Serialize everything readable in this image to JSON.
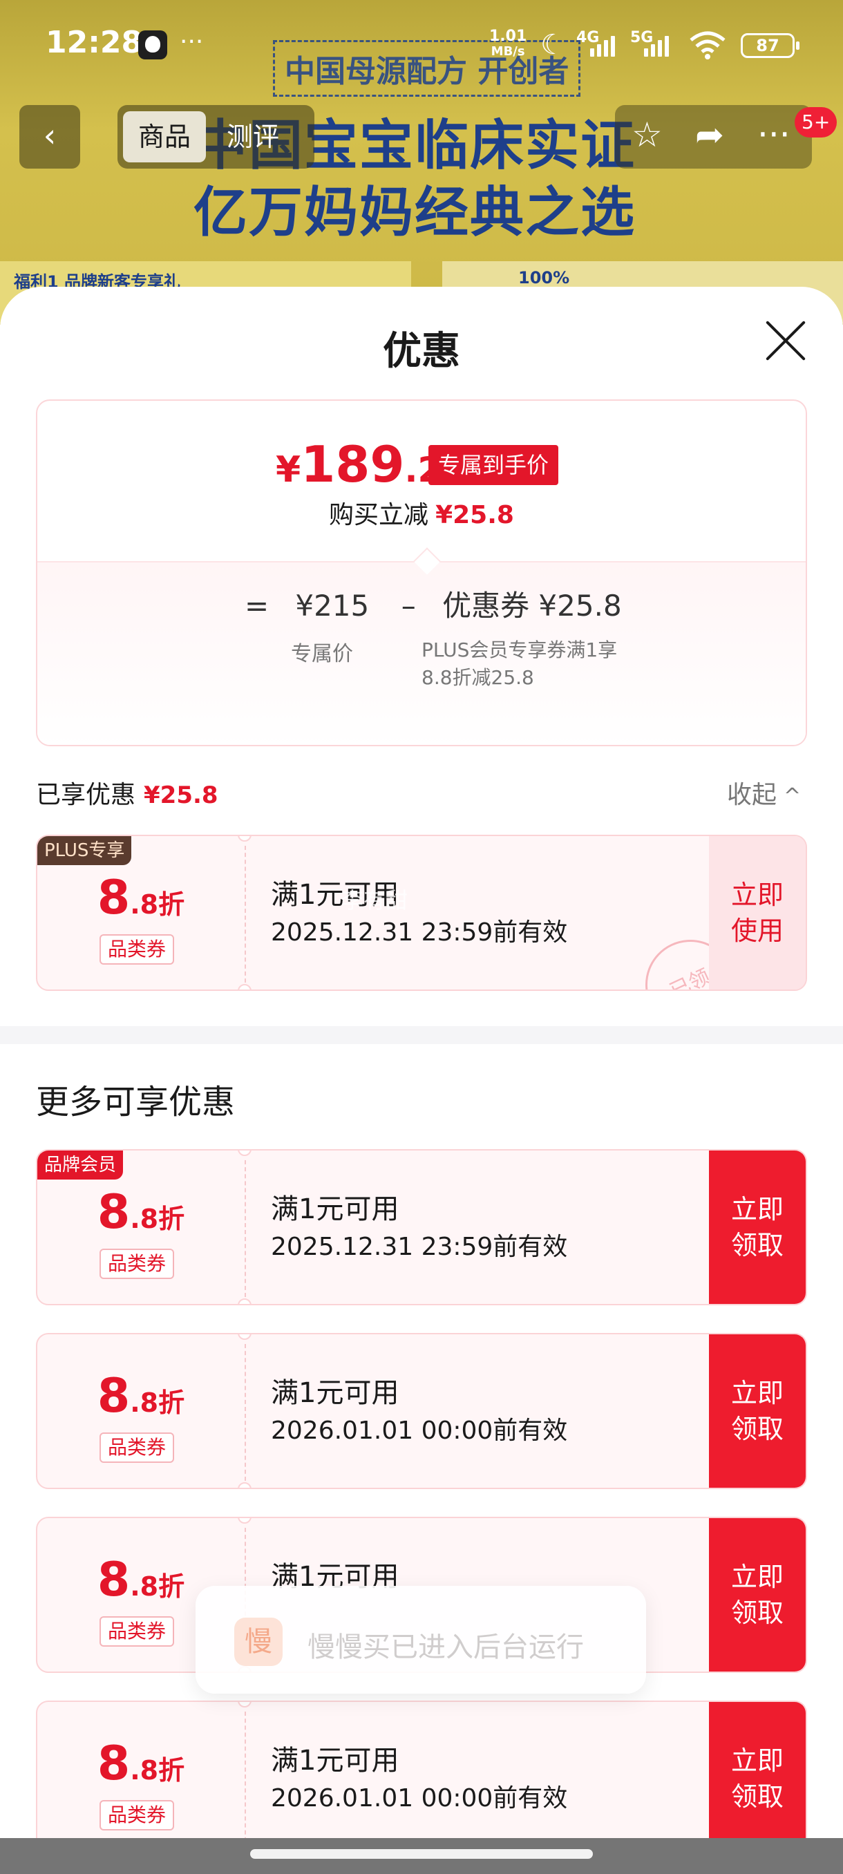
{
  "banner": {
    "line1": "中国母源配方 开创者",
    "line2": "中国宝宝临床实证",
    "line3": "亿万妈妈经典之选",
    "strip_text": "福利1 品牌新客专享礼",
    "strip_text2": "100%"
  },
  "status_bar": {
    "time": "12:28",
    "dots": "···",
    "net_speed_value": "1.01",
    "net_speed_unit": "MB/s",
    "sig_4g": "4G",
    "sig_5g": "5G",
    "battery": "87"
  },
  "product_nav": {
    "back_icon": "‹",
    "tabs": [
      "商品",
      "测评"
    ],
    "msg_badge": "5+"
  },
  "sheet": {
    "title": "优惠",
    "price_card": {
      "yen": "¥",
      "price_int": "189",
      "price_dec": ".2",
      "exclusive_tag": "专属到手价",
      "instant_cut_label": "购买立减",
      "instant_cut_value": "¥25.8",
      "eq": "=",
      "base_price": "¥215",
      "minus": "–",
      "coupon_label": "优惠券 ¥25.8",
      "base_price_label": "专属价",
      "coupon_desc": "PLUS会员专享券满1享8.8折减25.8"
    },
    "enjoyed": {
      "label": "已享优惠",
      "value": "¥25.8",
      "collapse": "收起",
      "collapse_icon": "^"
    },
    "more_title": "更多可享优惠"
  },
  "coupons": [
    {
      "corner": "PLUS专享",
      "disc_big": "8",
      "disc_small": ".8折",
      "category": "品类券",
      "condition": "满1元可用",
      "valid": "2025.12.31 23:59前有效",
      "action_line1": "立即",
      "action_line2": "使用",
      "stamp": "已领",
      "watermark": "李有甜"
    },
    {
      "corner": "品牌会员",
      "disc_big": "8",
      "disc_small": ".8折",
      "category": "品类券",
      "condition": "满1元可用",
      "valid": "2025.12.31 23:59前有效",
      "action_line1": "立即",
      "action_line2": "领取"
    },
    {
      "disc_big": "8",
      "disc_small": ".8折",
      "category": "品类券",
      "condition": "满1元可用",
      "valid": "2026.01.01 00:00前有效",
      "action_line1": "立即",
      "action_line2": "领取"
    },
    {
      "disc_big": "8",
      "disc_small": ".8折",
      "category": "品类券",
      "condition": "满1元可用",
      "action_line1": "立即",
      "action_line2": "领取"
    },
    {
      "disc_big": "8",
      "disc_small": ".8折",
      "category": "品类券",
      "condition": "满1元可用",
      "valid": "2026.01.01 00:00前有效",
      "action_line1": "立即",
      "action_line2": "领取"
    }
  ],
  "toast": {
    "app_icon_char": "慢",
    "message": "慢慢买已进入后台运行"
  },
  "colors": {
    "accent_red": "#e3162a",
    "button_red": "#ee1c2e",
    "plus_brown": "#5a3b2e"
  }
}
